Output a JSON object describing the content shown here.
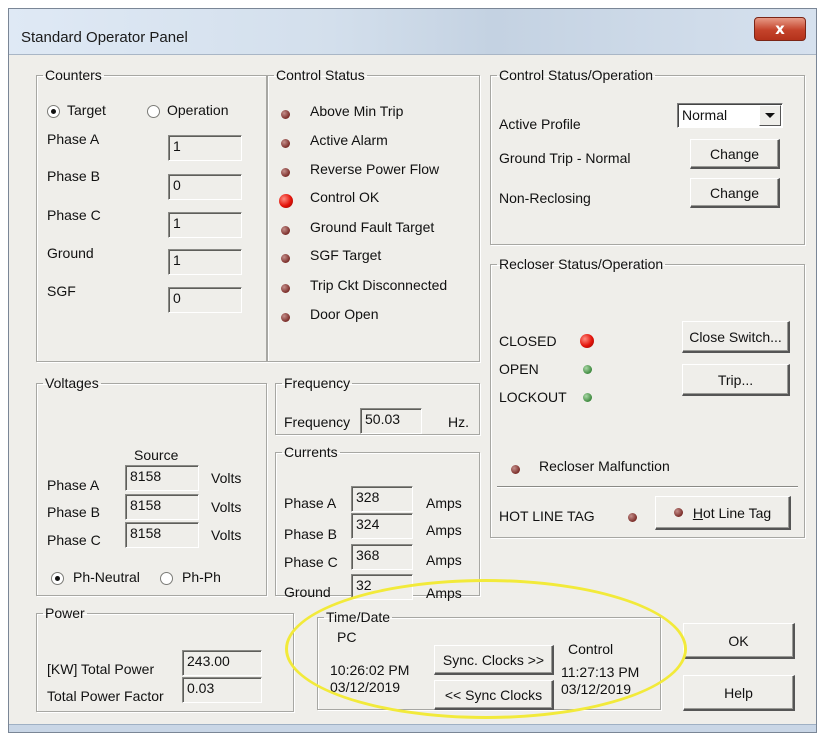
{
  "window": {
    "title": "Standard Operator Panel",
    "close_label": "x"
  },
  "counters": {
    "legend": "Counters",
    "radio_target": "Target",
    "radio_operation": "Operation",
    "selected": "Target",
    "rows": [
      {
        "label": "Phase A",
        "value": "1"
      },
      {
        "label": "Phase B",
        "value": "0"
      },
      {
        "label": "Phase C",
        "value": "1"
      },
      {
        "label": "Ground",
        "value": "1"
      },
      {
        "label": "SGF",
        "value": "0"
      }
    ]
  },
  "control_status": {
    "legend": "Control Status",
    "items": [
      {
        "label": "Above Min Trip",
        "state": "off"
      },
      {
        "label": "Active Alarm",
        "state": "off"
      },
      {
        "label": "Reverse Power Flow",
        "state": "off"
      },
      {
        "label": "Control OK",
        "state": "on"
      },
      {
        "label": "Ground Fault Target",
        "state": "off"
      },
      {
        "label": "SGF Target",
        "state": "off"
      },
      {
        "label": "Trip Ckt Disconnected",
        "state": "off"
      },
      {
        "label": "Door Open",
        "state": "off"
      }
    ]
  },
  "control_ops": {
    "legend": "Control Status/Operation",
    "active_profile_label": "Active Profile",
    "active_profile_value": "Normal",
    "ground_trip_label": "Ground Trip - Normal",
    "ground_trip_button": "Change",
    "non_reclosing_label": "Non-Reclosing",
    "non_reclosing_button": "Change"
  },
  "recloser": {
    "legend": "Recloser Status/Operation",
    "closed_label": "CLOSED",
    "open_label": "OPEN",
    "lockout_label": "LOCKOUT",
    "close_button": "Close Switch...",
    "trip_button": "Trip...",
    "malfunction_label": "Recloser Malfunction",
    "hot_line_label": "HOT LINE TAG",
    "hot_line_button_first": "H",
    "hot_line_button_rest": "ot Line Tag"
  },
  "voltages": {
    "legend": "Voltages",
    "source_header": "Source",
    "rows": [
      {
        "label": "Phase A",
        "value": "8158",
        "unit": "Volts"
      },
      {
        "label": "Phase B",
        "value": "8158",
        "unit": "Volts"
      },
      {
        "label": "Phase C",
        "value": "8158",
        "unit": "Volts"
      }
    ],
    "radio_ph_neutral": "Ph-Neutral",
    "radio_ph_ph": "Ph-Ph",
    "selected": "Ph-Neutral"
  },
  "frequency": {
    "legend": "Frequency",
    "label": "Frequency",
    "value": "50.03",
    "unit": "Hz."
  },
  "currents": {
    "legend": "Currents",
    "rows": [
      {
        "label": "Phase A",
        "value": "328",
        "unit": "Amps"
      },
      {
        "label": "Phase B",
        "value": "324",
        "unit": "Amps"
      },
      {
        "label": "Phase C",
        "value": "368",
        "unit": "Amps"
      },
      {
        "label": "Ground",
        "value": "32",
        "unit": "Amps"
      }
    ]
  },
  "power": {
    "legend": "Power",
    "total_power_label": "[KW] Total Power",
    "total_power_value": "243.00",
    "power_factor_label": "Total Power Factor",
    "power_factor_value": "0.03"
  },
  "time_date": {
    "legend": "Time/Date",
    "pc_label": "PC",
    "pc_time": "10:26:02 PM",
    "pc_date": "03/12/2019",
    "sync_to_control": "Sync. Clocks >>",
    "sync_to_pc": "<< Sync Clocks",
    "control_label": "Control",
    "control_time": "11:27:13 PM",
    "control_date": "03/12/2019"
  },
  "dialog_buttons": {
    "ok": "OK",
    "help": "Help"
  },
  "colors": {
    "led_on": "#e3130a",
    "led_off": "#7a2c28",
    "led_green": "#3f8a3f",
    "annotation": "#f2ea3a"
  }
}
